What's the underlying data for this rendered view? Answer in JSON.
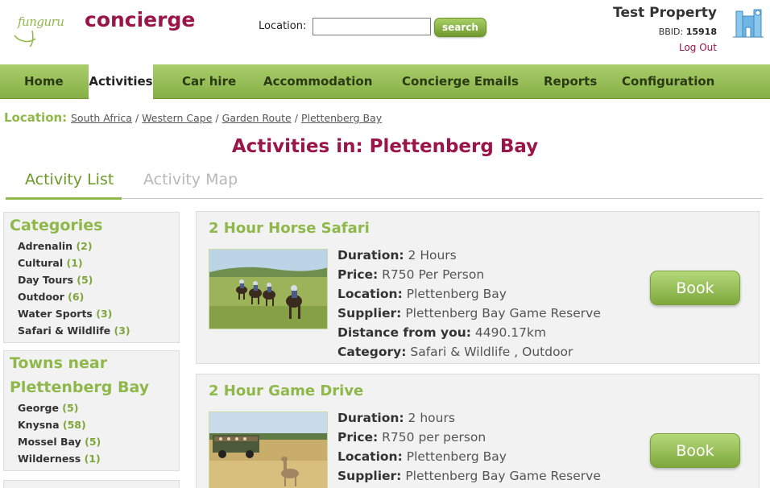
{
  "header": {
    "logo_text": "funguru",
    "brand": "concierge",
    "location_label": "Location:",
    "location_value": "",
    "search_label": "search",
    "property_name": "Test Property",
    "bbid_label": "BBID:",
    "bbid_value": "15918",
    "logout_label": "Log Out"
  },
  "nav": {
    "items": [
      {
        "label": "Home"
      },
      {
        "label": "Activities"
      },
      {
        "label": "Car hire"
      },
      {
        "label": "Accommodation"
      },
      {
        "label": "Concierge Emails"
      },
      {
        "label": "Reports"
      },
      {
        "label": "Configuration"
      }
    ],
    "active": "Activities"
  },
  "breadcrumb": {
    "label": "Location:",
    "items": [
      "South Africa",
      "Western Cape",
      "Garden Route",
      "Plettenberg Bay"
    ],
    "separator": "/"
  },
  "page_title": "Activities in: Plettenberg Bay",
  "tabs": [
    {
      "label": "Activity List"
    },
    {
      "label": "Activity Map"
    }
  ],
  "sidebar": {
    "categories": {
      "title": "Categories",
      "items": [
        {
          "name": "Adrenalin",
          "count": "(2)"
        },
        {
          "name": "Cultural",
          "count": "(1)"
        },
        {
          "name": "Day Tours",
          "count": "(5)"
        },
        {
          "name": "Outdoor",
          "count": "(6)"
        },
        {
          "name": "Water Sports",
          "count": "(3)"
        },
        {
          "name": "Safari & Wildlife",
          "count": "(3)"
        }
      ]
    },
    "towns": {
      "title_line1": "Towns near",
      "title_line2": "Plettenberg Bay",
      "items": [
        {
          "name": "George",
          "count": "(5)"
        },
        {
          "name": "Knysna",
          "count": "(58)"
        },
        {
          "name": "Mossel Bay",
          "count": "(5)"
        },
        {
          "name": "Wilderness",
          "count": "(1)"
        }
      ]
    }
  },
  "activities": [
    {
      "title": "2 Hour Horse Safari",
      "fields": [
        {
          "label": "Duration:",
          "value": "2 Hours"
        },
        {
          "label": "Price:",
          "value": "R750 Per Person"
        },
        {
          "label": "Location:",
          "value": "Plettenberg Bay"
        },
        {
          "label": "Supplier:",
          "value": "Plettenberg Bay Game Reserve"
        },
        {
          "label": "Distance from you:",
          "value": "4490.17km"
        },
        {
          "label": "Category:",
          "value": "Safari & Wildlife , Outdoor"
        }
      ],
      "book_label": "Book",
      "image_icon": "horse-safari-photo"
    },
    {
      "title": "2 Hour Game Drive",
      "fields": [
        {
          "label": "Duration:",
          "value": "2 hours"
        },
        {
          "label": "Price:",
          "value": "R750 per person"
        },
        {
          "label": "Location:",
          "value": "Plettenberg Bay"
        },
        {
          "label": "Supplier:",
          "value": "Plettenberg Bay Game Reserve"
        }
      ],
      "book_label": "Book",
      "image_icon": "game-drive-photo"
    }
  ],
  "colors": {
    "brand": "#9a1548",
    "accent_green": "#8fb84a",
    "nav_green": "#a9cd6a"
  }
}
